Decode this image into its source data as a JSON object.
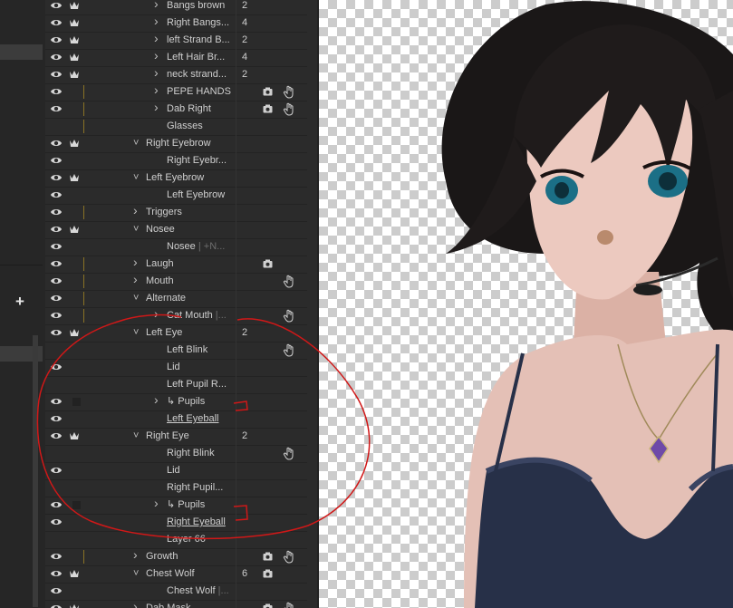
{
  "layers": [
    {
      "name": "Bangs brown",
      "count": "2",
      "eye": true,
      "crown": true,
      "chev": "right",
      "indent": 3
    },
    {
      "name": "Right Bangs...",
      "count": "4",
      "eye": true,
      "crown": true,
      "chev": "right",
      "indent": 3
    },
    {
      "name": "left Strand B...",
      "count": "2",
      "eye": true,
      "crown": true,
      "chev": "right",
      "indent": 3
    },
    {
      "name": "Left Hair Br...",
      "count": "4",
      "eye": true,
      "crown": true,
      "chev": "right",
      "indent": 3
    },
    {
      "name": "neck strand...",
      "count": "2",
      "eye": true,
      "crown": true,
      "chev": "right",
      "indent": 3
    },
    {
      "name": "PEPE HANDS",
      "eye": true,
      "ybar": true,
      "chev": "right",
      "indent": 3,
      "cam": true,
      "hand": true
    },
    {
      "name": "Dab Right",
      "eye": true,
      "ybar": true,
      "chev": "right",
      "indent": 3,
      "cam": true,
      "hand": true
    },
    {
      "name": "Glasses",
      "eye": false,
      "ybar": true,
      "indent": 3
    },
    {
      "name": "Right Eyebrow",
      "eye": true,
      "crown": true,
      "chev": "down",
      "indent": 2
    },
    {
      "name": "Right Eyebr...",
      "eye": true,
      "indent": 3
    },
    {
      "name": "Left Eyebrow",
      "eye": true,
      "crown": true,
      "chev": "down",
      "indent": 2
    },
    {
      "name": "Left Eyebrow",
      "eye": true,
      "indent": 3
    },
    {
      "name": "Triggers",
      "eye": true,
      "ybar": true,
      "chev": "right",
      "indent": 2
    },
    {
      "name": "Nosee",
      "eye": true,
      "crown": true,
      "chev": "down",
      "indent": 2
    },
    {
      "name": "Nosee",
      "suffix": "| +N...",
      "eye": true,
      "indent": 3
    },
    {
      "name": "Laugh",
      "eye": true,
      "ybar": true,
      "chev": "right",
      "indent": 2,
      "cam": true
    },
    {
      "name": "Mouth",
      "eye": true,
      "ybar": true,
      "chev": "right",
      "indent": 2,
      "hand": true
    },
    {
      "name": "Alternate",
      "eye": true,
      "ybar": true,
      "chev": "down",
      "indent": 2
    },
    {
      "name": "Cat Mouth",
      "suffix": "|...",
      "eye": true,
      "ybar": true,
      "chev": "right",
      "indent": 3,
      "hand": true
    },
    {
      "name": "Left Eye",
      "count": "2",
      "eye": true,
      "crown": true,
      "chev": "down",
      "indent": 2
    },
    {
      "name": "Left Blink",
      "eye": false,
      "indent": 3,
      "hand": true
    },
    {
      "name": "Lid",
      "eye": true,
      "indent": 3
    },
    {
      "name": "Left Pupil R...",
      "eye": false,
      "indent": 3
    },
    {
      "name": "↳ Pupils",
      "eye": true,
      "gbox": true,
      "chev": "right",
      "indent": 3
    },
    {
      "name": "Left Eyeball",
      "eye": true,
      "indent": 3,
      "underline": true
    },
    {
      "name": "Right Eye",
      "count": "2",
      "eye": true,
      "crown": true,
      "chev": "down",
      "indent": 2
    },
    {
      "name": "Right Blink",
      "eye": false,
      "indent": 3,
      "hand": true
    },
    {
      "name": "Lid",
      "eye": true,
      "indent": 3
    },
    {
      "name": "Right Pupil...",
      "eye": false,
      "indent": 3
    },
    {
      "name": "↳ Pupils",
      "eye": true,
      "gbox": true,
      "chev": "right",
      "indent": 3
    },
    {
      "name": "Right Eyeball",
      "eye": true,
      "indent": 3,
      "underline": true
    },
    {
      "name": "Layer 66",
      "eye": false,
      "indent": 3
    },
    {
      "name": "Growth",
      "eye": true,
      "ybar": true,
      "chev": "right",
      "indent": 2,
      "cam": true,
      "hand": true
    },
    {
      "name": "Chest Wolf",
      "count": "6",
      "eye": true,
      "crown": true,
      "chev": "down",
      "indent": 2,
      "cam": true
    },
    {
      "name": "Chest Wolf",
      "suffix": "|...",
      "eye": true,
      "indent": 3
    },
    {
      "name": "Dab Mask",
      "eye": true,
      "crown": true,
      "chev": "right",
      "indent": 2,
      "cam": true,
      "hand": true
    }
  ],
  "colors": {
    "annotation": "#d01818",
    "accent_bar": "#8a7325"
  },
  "icons": {
    "visibility": "eye-icon",
    "puppet": "crown-icon",
    "camera": "camera-icon",
    "drag": "hand-icon",
    "add": "plus-icon"
  },
  "add_label": "+"
}
